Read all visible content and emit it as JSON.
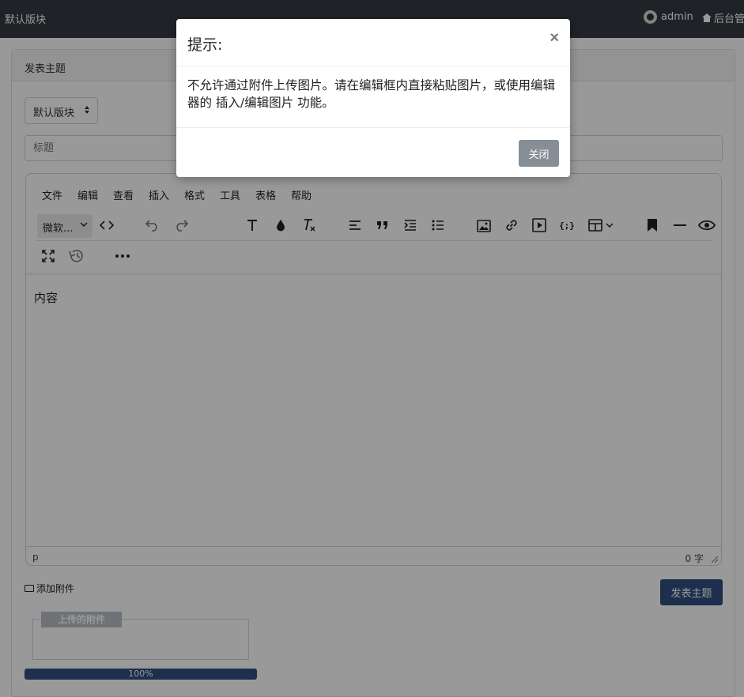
{
  "navbar": {
    "brand": "默认版块",
    "user": "admin",
    "backend": "后台管理"
  },
  "card": {
    "header_title": "发表主题"
  },
  "form": {
    "forum_select_value": "默认版块",
    "title_placeholder": "标题"
  },
  "editor": {
    "menus": [
      "文件",
      "编辑",
      "查看",
      "插入",
      "格式",
      "工具",
      "表格",
      "帮助"
    ],
    "font_family_value": "微软...",
    "content_placeholder": "内容",
    "status_path": "p",
    "word_count": "0 字"
  },
  "attachments": {
    "add_label": "添加附件",
    "legend": "上传的附件",
    "progress_label": "100%",
    "progress_value": 100
  },
  "publish_button": "发表主题",
  "modal": {
    "title": "提示:",
    "close_symbol": "×",
    "message": "不允许通过附件上传图片。请在编辑框内直接粘贴图片，或使用编辑器的 插入/编辑图片 功能。",
    "close_button": "关闭"
  },
  "colors": {
    "navbar_bg": "#343a40",
    "primary": "#2f4f80",
    "secondary_button": "#868e96",
    "backdrop": "rgba(0,0,0,0.4)"
  }
}
